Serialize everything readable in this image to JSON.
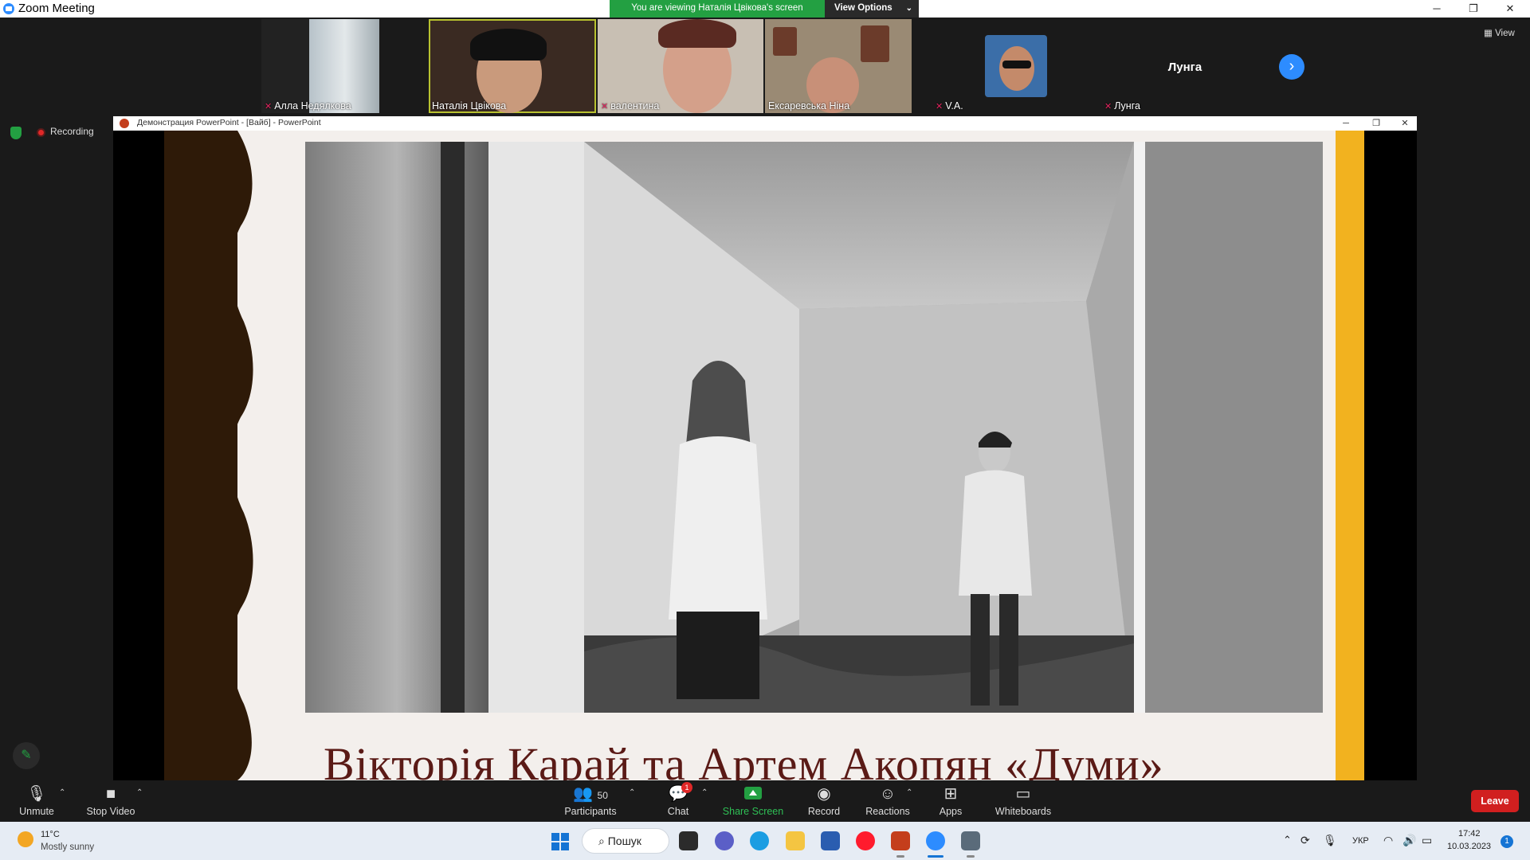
{
  "window": {
    "title": "Zoom Meeting",
    "minimize_icon": "─",
    "restore_icon": "❐",
    "close_icon": "✕"
  },
  "banner": {
    "viewing_text": "You are viewing Наталія Цвікова's screen",
    "view_options_label": "View Options",
    "view_options_chevron": "⌄"
  },
  "participants_strip": {
    "tiles": [
      {
        "name": "Алла Недялкова",
        "muted": true
      },
      {
        "name": "Наталія Цвікова",
        "muted": false,
        "active_speaker": true
      },
      {
        "name": "валентина",
        "muted": true
      },
      {
        "name": "Ексаревська Ніна",
        "muted": false
      },
      {
        "name": "V.A.",
        "muted": true
      },
      {
        "name": "Лунга",
        "muted": true,
        "display_name": "Лунга"
      }
    ],
    "next_page_icon": "›",
    "view_label": "View",
    "view_icon": "▦",
    "mic_off_icon": "✕"
  },
  "status": {
    "recording_label": "Recording"
  },
  "shared_screen": {
    "window_title": "Демонстрация PowerPoint - [Вайб] - PowerPoint",
    "slide_title": "Вікторія Карай та Артем Акопян «Думи»",
    "colors": {
      "left_band": "#2e1a08",
      "right_band": "#f2b21f",
      "title_text": "#5a1a16"
    }
  },
  "toolbar": {
    "unmute_label": "Unmute",
    "stop_video_label": "Stop Video",
    "participants_label": "Participants",
    "participants_count": "50",
    "chat_label": "Chat",
    "chat_badge": "1",
    "share_screen_label": "Share Screen",
    "record_label": "Record",
    "reactions_label": "Reactions",
    "apps_label": "Apps",
    "whiteboards_label": "Whiteboards",
    "leave_label": "Leave",
    "caret": "⌃"
  },
  "taskbar": {
    "weather_temp": "11°C",
    "weather_desc": "Mostly sunny",
    "search_label": "⌕ Пошук",
    "language": "УКР",
    "time": "17:42",
    "date": "10.03.2023",
    "notification_count": "1",
    "tray_up_icon": "⌃"
  }
}
